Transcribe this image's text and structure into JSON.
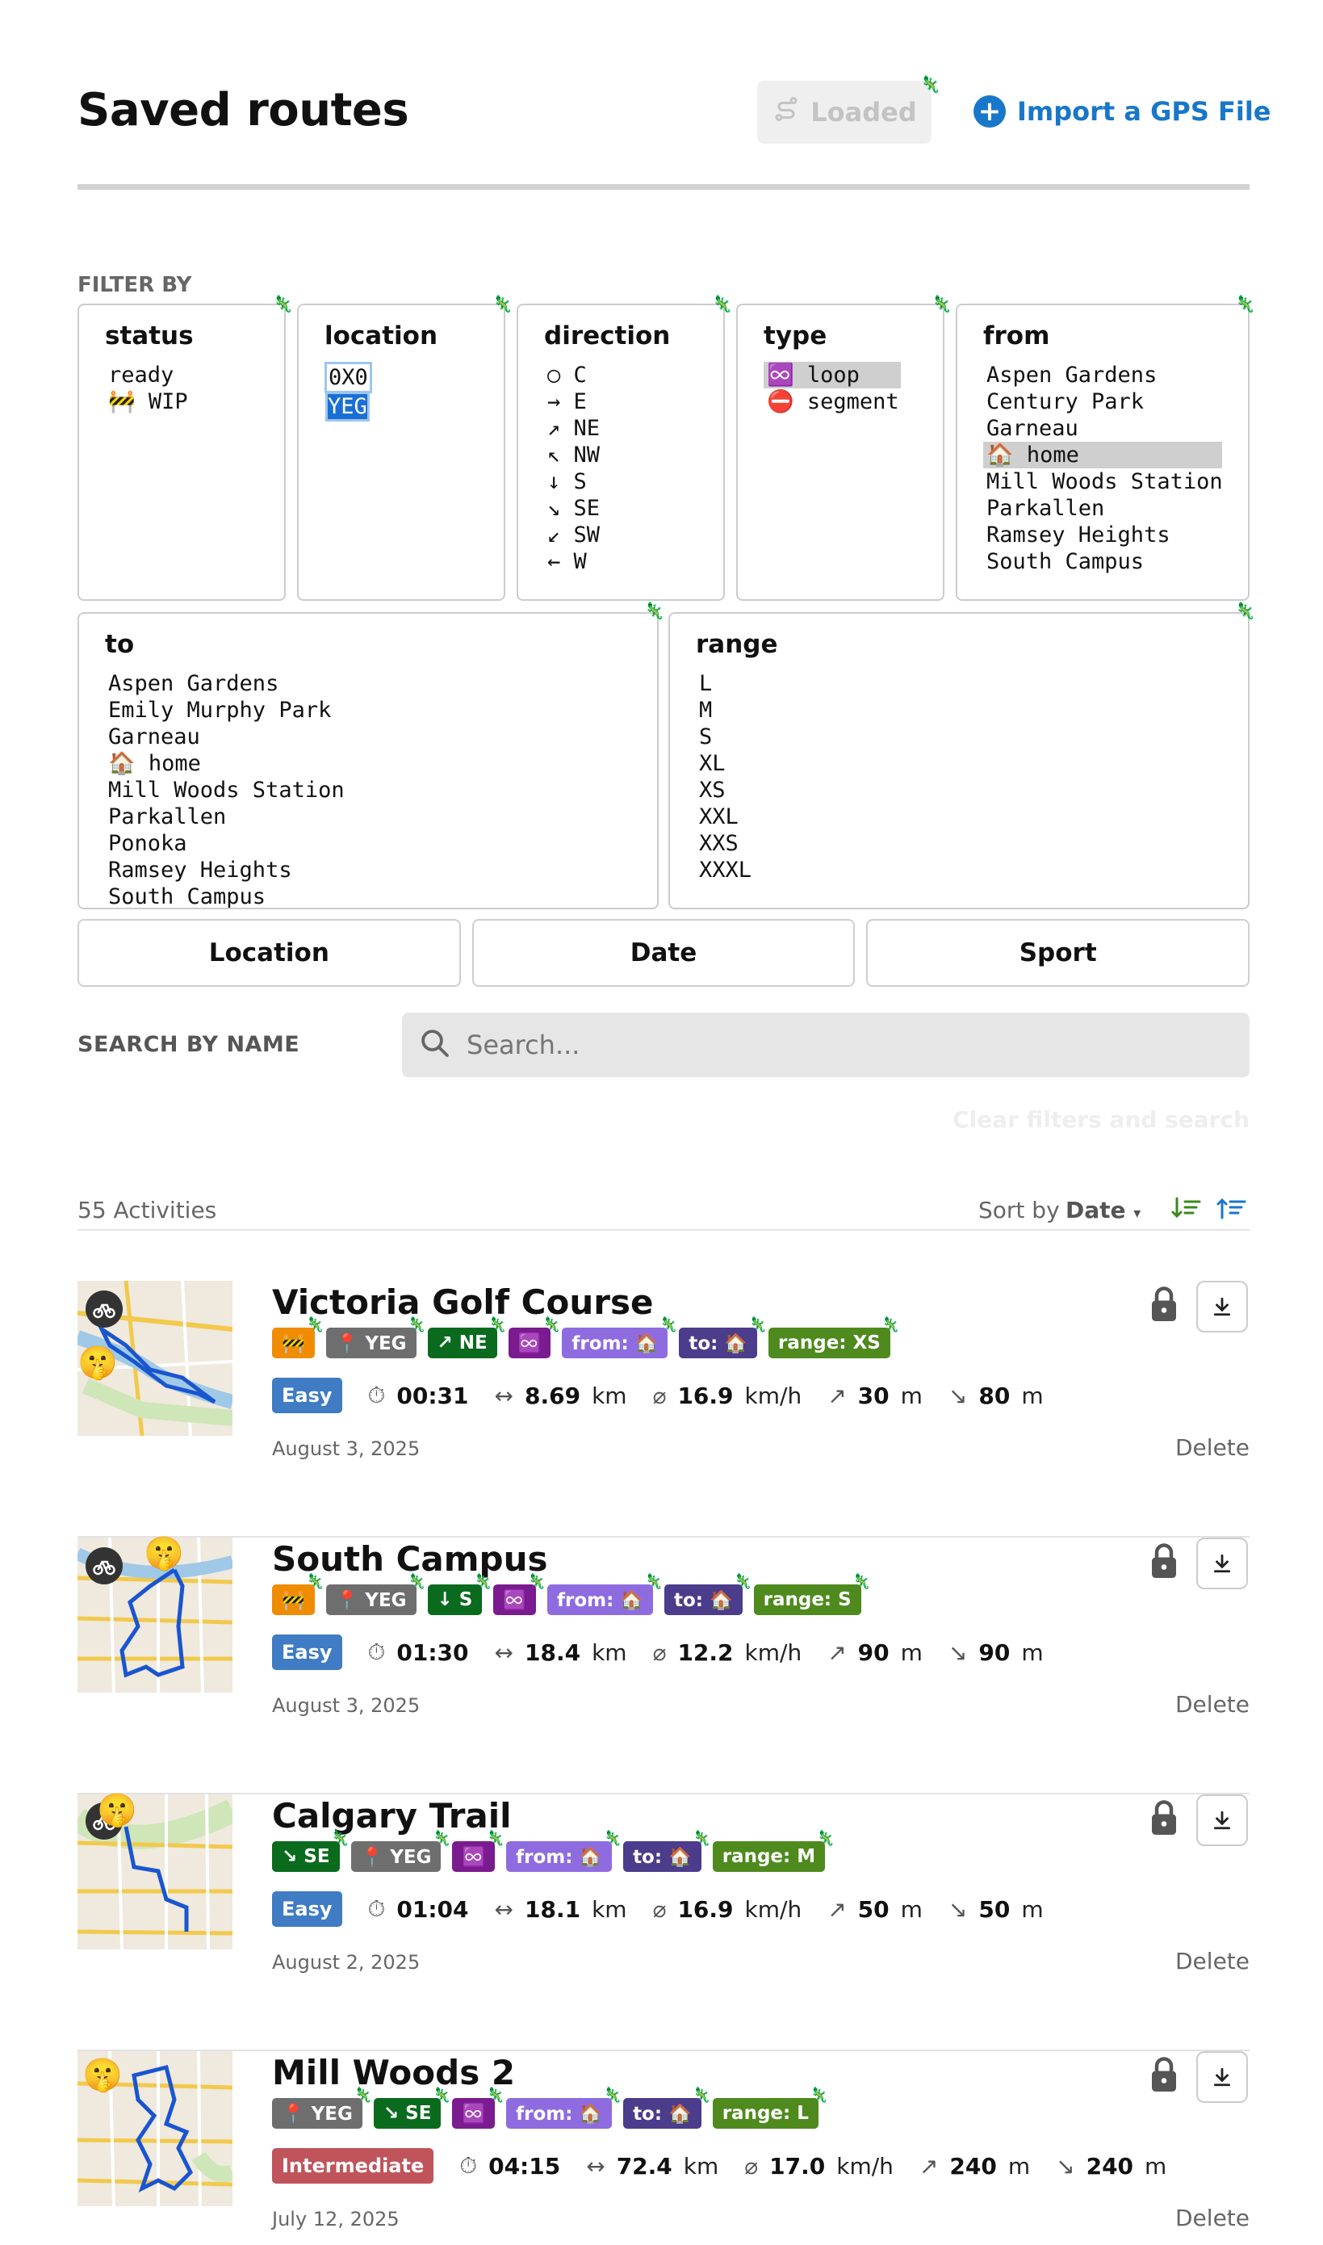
{
  "header": {
    "title": "Saved routes",
    "loaded_label": "Loaded",
    "import_label": "Import a GPS File"
  },
  "filters": {
    "heading": "FILTER BY",
    "status": {
      "title": "status",
      "items": [
        "ready",
        "🚧 WIP"
      ]
    },
    "location": {
      "title": "location",
      "items": [
        "0X0",
        "YEG"
      ]
    },
    "direction": {
      "title": "direction",
      "items": [
        "○ C",
        "→ E",
        "↗ NE",
        "↖ NW",
        "↓ S",
        "↘ SE",
        "↙ SW",
        "← W"
      ]
    },
    "type": {
      "title": "type",
      "items": [
        "♾️ loop",
        "⛔ segment"
      ]
    },
    "from": {
      "title": "from",
      "items": [
        "Aspen Gardens",
        "Century Park",
        "Garneau",
        "🏠 home",
        "Mill Woods Station",
        "Parkallen",
        "Ramsey Heights",
        "South Campus"
      ]
    },
    "to": {
      "title": "to",
      "items": [
        "Aspen Gardens",
        "Emily Murphy Park",
        "Garneau",
        "🏠 home",
        "Mill Woods Station",
        "Parkallen",
        "Ponoka",
        "Ramsey Heights",
        "South Campus"
      ]
    },
    "range": {
      "title": "range",
      "items": [
        "L",
        "M",
        "S",
        "XL",
        "XS",
        "XXL",
        "XXS",
        "XXXL"
      ]
    }
  },
  "sort_tabs": [
    "Location",
    "Date",
    "Sport"
  ],
  "search": {
    "label": "SEARCH BY NAME",
    "placeholder": "Search...",
    "clear_label": "Clear filters and search"
  },
  "list": {
    "count_label": "55 Activities",
    "sort_by_label": "Sort by",
    "sort_value": "Date"
  },
  "activities": [
    {
      "title": "Victoria Golf Course",
      "tags": [
        "🚧",
        "📍 YEG",
        "↗ NE",
        "♾️",
        "from: 🏠",
        "to: 🏠",
        "range: XS"
      ],
      "level": "Easy",
      "time": "00:31",
      "distance": "8.69",
      "distance_unit": "km",
      "speed": "16.9",
      "speed_unit": "km/h",
      "ascent": "30",
      "ascent_unit": "m",
      "descent": "80",
      "descent_unit": "m",
      "date": "August 3, 2025",
      "delete_label": "Delete"
    },
    {
      "title": "South Campus",
      "tags": [
        "🚧",
        "📍 YEG",
        "↓ S",
        "♾️",
        "from: 🏠",
        "to: 🏠",
        "range: S"
      ],
      "level": "Easy",
      "time": "01:30",
      "distance": "18.4",
      "distance_unit": "km",
      "speed": "12.2",
      "speed_unit": "km/h",
      "ascent": "90",
      "ascent_unit": "m",
      "descent": "90",
      "descent_unit": "m",
      "date": "August 3, 2025",
      "delete_label": "Delete"
    },
    {
      "title": "Calgary Trail",
      "tags": [
        "↘ SE",
        "📍 YEG",
        "♾️",
        "from: 🏠",
        "to: 🏠",
        "range: M"
      ],
      "level": "Easy",
      "time": "01:04",
      "distance": "18.1",
      "distance_unit": "km",
      "speed": "16.9",
      "speed_unit": "km/h",
      "ascent": "50",
      "ascent_unit": "m",
      "descent": "50",
      "descent_unit": "m",
      "date": "August 2, 2025",
      "delete_label": "Delete"
    },
    {
      "title": "Mill Woods 2",
      "tags": [
        "📍 YEG",
        "↘ SE",
        "♾️",
        "from: 🏠",
        "to: 🏠",
        "range: L"
      ],
      "level": "Intermediate",
      "time": "04:15",
      "distance": "72.4",
      "distance_unit": "km",
      "speed": "17.0",
      "speed_unit": "km/h",
      "ascent": "240",
      "ascent_unit": "m",
      "descent": "240",
      "descent_unit": "m",
      "date": "July 12, 2025",
      "delete_label": "Delete"
    }
  ],
  "colors": {
    "accent": "#1877c9",
    "tag_wip": "#f08c00",
    "tag_location": "#6e6e6e",
    "tag_direction": "#0a6b1e",
    "tag_loop": "#7a1b8f",
    "tag_from": "#8e6ce0",
    "tag_to": "#4b3c8c",
    "tag_range": "#4e8a1d",
    "level_easy": "#3f7cc4",
    "level_intermediate": "#c0545b"
  }
}
